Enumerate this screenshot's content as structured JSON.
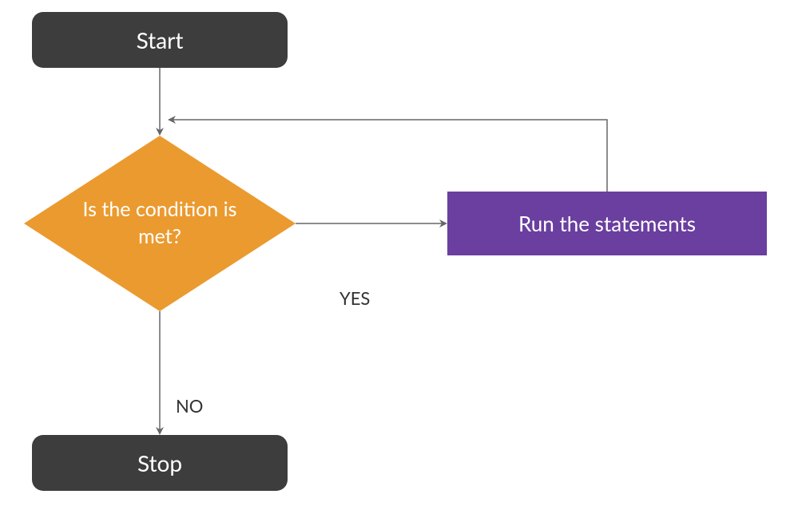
{
  "nodes": {
    "start": "Start",
    "decision": "Is the condition is met?",
    "process": "Run the statements",
    "stop": "Stop"
  },
  "edges": {
    "yes": "YES",
    "no": "NO"
  },
  "colors": {
    "terminal_bg": "#3d3d3d",
    "decision_bg": "#eb9a2f",
    "process_bg": "#6a3fa0",
    "text_on_dark": "#ffffff",
    "arrow": "#666666",
    "edge_label": "#333333"
  }
}
